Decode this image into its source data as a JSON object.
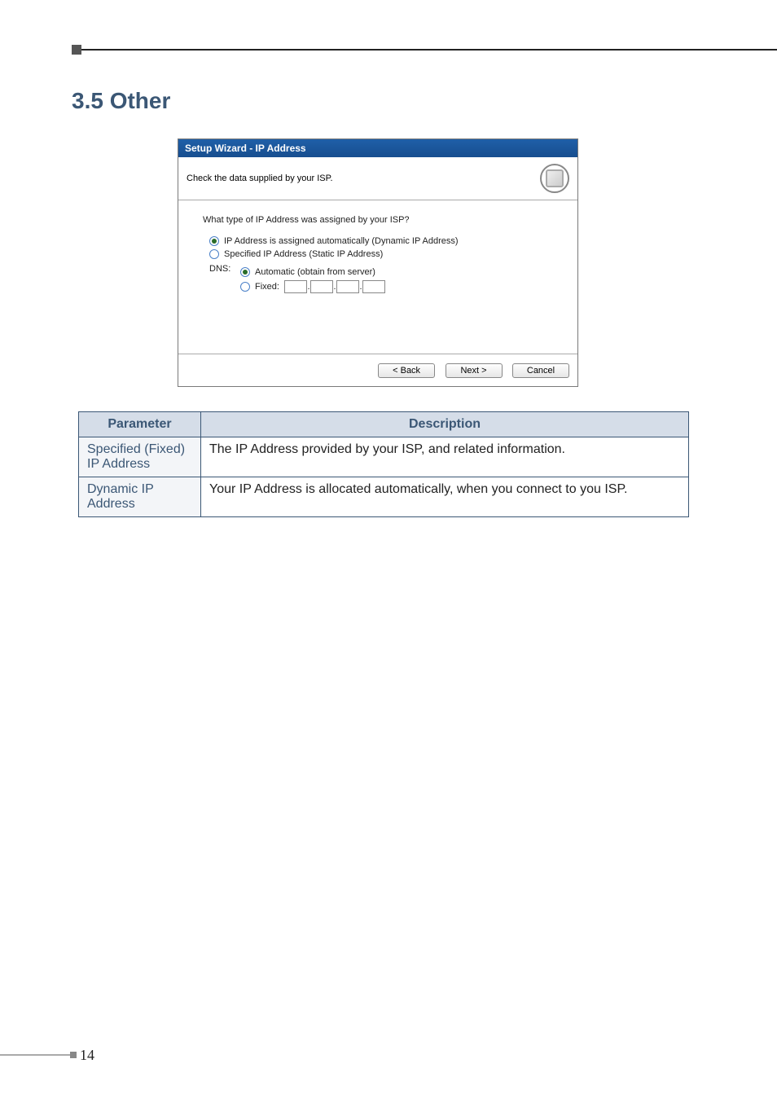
{
  "heading": "3.5 Other",
  "wizard": {
    "title": "Setup Wizard - IP Address",
    "subhead": "Check the data supplied by your ISP.",
    "question": "What type of IP Address was assigned by your ISP?",
    "opt_dynamic": "IP Address is assigned automatically (Dynamic IP Address)",
    "opt_static": "Specified IP Address (Static IP Address)",
    "dns_label": "DNS:",
    "dns_auto": "Automatic (obtain from server)",
    "dns_fixed": "Fixed:",
    "btn_back": "< Back",
    "btn_next": "Next >",
    "btn_cancel": "Cancel"
  },
  "table": {
    "head_param": "Parameter",
    "head_desc": "Description",
    "rows": [
      {
        "param": "Specified (Fixed) IP Address",
        "desc": "The IP Address provided by your ISP, and related information."
      },
      {
        "param": "Dynamic IP Address",
        "desc": "Your IP Address is allocated automatically, when you connect to you ISP."
      }
    ]
  },
  "page_number": "14"
}
